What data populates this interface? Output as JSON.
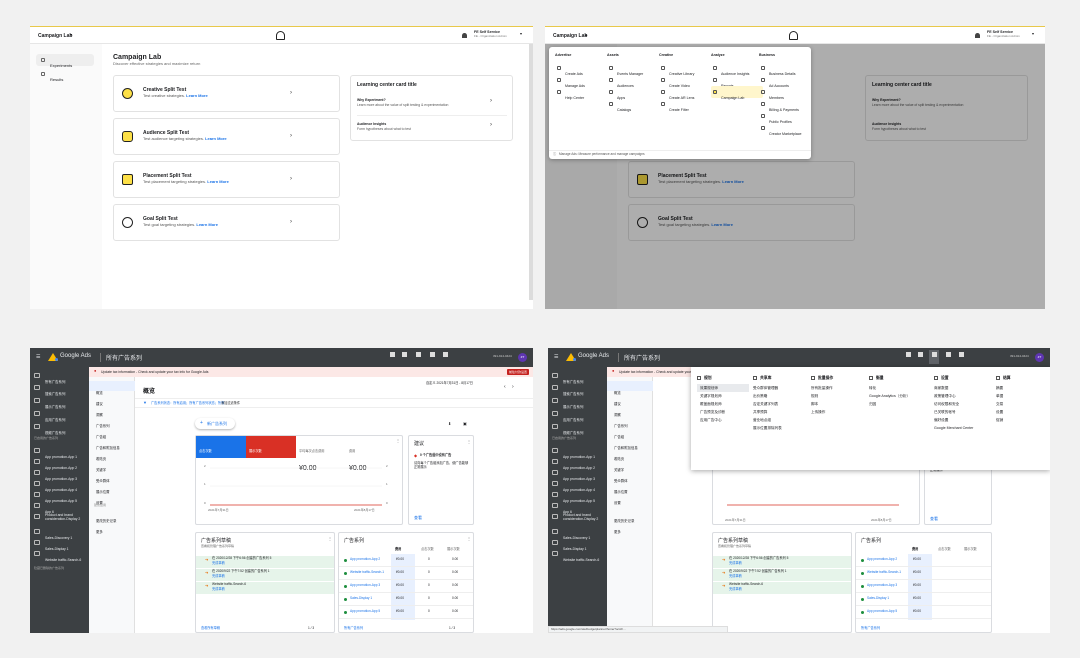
{
  "snap": {
    "brand": "Campaign Lab",
    "account_name": "FE Self Service",
    "account_sub": "FE - Organization Admin",
    "sidebar": [
      {
        "label": "Experiments"
      },
      {
        "label": "Results"
      }
    ],
    "title": "Campaign Lab",
    "subtitle": "Discover effective strategies and maximize return",
    "cards": [
      {
        "title": "Creative Split Test",
        "desc": "Test creative strategies.",
        "link": "Learn More"
      },
      {
        "title": "Audience Split Test",
        "desc": "Test audience targeting strategies.",
        "link": "Learn More"
      },
      {
        "title": "Placement Split Test",
        "desc": "Test placement targeting strategies.",
        "link": "Learn More"
      },
      {
        "title": "Goal Split Test",
        "desc": "Test goal targeting strategies.",
        "link": "Learn More"
      }
    ],
    "learning": {
      "title": "Learning center card title",
      "items": [
        {
          "title": "Why Experiment?",
          "desc": "Learn more about the value of split testing & experimentation"
        },
        {
          "title": "Audience Insights",
          "desc": "Form hypotheses about what to test"
        }
      ]
    },
    "menu": {
      "columns": [
        {
          "header": "Advertise",
          "items": [
            "Create Ads",
            "Manage Ads",
            "Help Center"
          ]
        },
        {
          "header": "Assets",
          "items": [
            "Events Manager",
            "Audiences",
            "Apps",
            "Catalogs"
          ]
        },
        {
          "header": "Creative",
          "items": [
            "Creative Library",
            "Create Video",
            "Create AR Lens",
            "Create Filter"
          ]
        },
        {
          "header": "Analyze",
          "items": [
            "Audience Insights",
            "Reports",
            "Campaign Lab"
          ]
        },
        {
          "header": "Business",
          "items": [
            "Business Details",
            "Ad Accounts",
            "Members",
            "Billing & Payments",
            "Public Profiles",
            "Creator Marketplace"
          ]
        }
      ],
      "footer": "Manage Ads: Measure performance and manage campaigns"
    }
  },
  "gads": {
    "product": "Google Ads",
    "page_title": "所有广告系列",
    "tools": [
      "搜索",
      "报告",
      "工具和设置",
      "帮助",
      "通知"
    ],
    "account_id": "391-914-0424",
    "avatar": "ZT",
    "banner": "Update tax information - Check and update your tax info for Google Ads",
    "banner_btn": "前往付款设置",
    "left_nav": [
      "所有广告系列",
      "搜索广告系列",
      "展示广告系列",
      "应用广告系列",
      "视频广告系列"
    ],
    "left_nav_group": "已启用的广告系列",
    "campaigns": [
      "App promotion-App 1",
      "App promotion-App 2",
      "App promotion-App 3",
      "App promotion-App 4",
      "App promotion-App 5",
      "App 6",
      "Product and brand consideration-Display 2",
      "Sales-Discovery 1",
      "Sales-Display 1",
      "Website traffic-Search-6"
    ],
    "left_footer": "隐藏已删除的广告系列",
    "sub_nav": [
      "概览",
      "建议",
      "洞察",
      "广告系列",
      "广告组",
      "广告和附加信息",
      "着陆页",
      "关键字",
      "受众群体",
      "展示位置",
      "设置",
      "更改历史记录"
    ],
    "sub_nav_group": "建议应用",
    "sub_nav_more": "更多",
    "overview": "概览",
    "filter_text": "广告系列状态：所有启用；所有广告系列状态；所有",
    "filter_add": "添加过滤条件",
    "date_range": "自定义 2021年7月31日 - 8月17日",
    "download": "下载",
    "feedback": "反馈",
    "new_campaign": "新广告系列",
    "metrics": [
      {
        "label": "点击次数",
        "value": "0"
      },
      {
        "label": "展示次数",
        "value": "0"
      },
      {
        "label": "平均每次点击费用",
        "value": "¥0.00"
      },
      {
        "label": "费用",
        "value": "¥0.00"
      }
    ],
    "chart_axis_left": [
      "2",
      "1",
      "0"
    ],
    "chart_axis_right": [
      "2",
      "1",
      "0"
    ],
    "chart_x_start": "2021年7月31日",
    "chart_x_end": "2021年8月17日",
    "suggest_title": "建议",
    "suggest_item": "0 个广告组中没有广告",
    "suggest_desc": "请向每个广告组添加广告，使广告能够正常展示",
    "view": "查看",
    "draft_title": "广告系列草稿",
    "draft_sub": "查看和管理广告系列草稿",
    "drafts": [
      {
        "title": "在 2020/12/28 下午6:56 创建的广告系列 5",
        "link": "完成草稿"
      },
      {
        "title": "在 2020/9/22 下午7:52 创建的广告系列 1",
        "link": "完成草稿"
      },
      {
        "title": "Website traffic-Search-6",
        "link": "完成草稿"
      }
    ],
    "all_drafts": "查看所有草稿",
    "camp_title": "广告系列",
    "camp_cols": [
      "费用",
      "点击次数",
      "展示次数"
    ],
    "camp_rows": [
      {
        "name": "App promotion-App 2",
        "cost": "¥0.00",
        "clicks": "0",
        "imp": "0.00"
      },
      {
        "name": "Website traffic-Search-1",
        "cost": "¥0.00",
        "clicks": "0",
        "imp": "0.00"
      },
      {
        "name": "App promotion-App 3",
        "cost": "¥0.00",
        "clicks": "0",
        "imp": "0.00"
      },
      {
        "name": "Sales-Display 1",
        "cost": "¥0.00",
        "clicks": "0",
        "imp": "0.00"
      },
      {
        "name": "App promotion-App 5",
        "cost": "¥0.00",
        "clicks": "0",
        "imp": "0.00"
      }
    ],
    "all_camps": "所有广告系列",
    "pager": "1 / 3",
    "status_url": "https://ads.google.com/aw/budgetplanner/home?ocid=...",
    "tools_menu": [
      {
        "header": "规划",
        "items": [
          "效果规划师",
          "关键字规划师",
          "覆盖面规划师",
          "广告预览及诊断",
          "应用广告中心"
        ]
      },
      {
        "header": "共享库",
        "items": [
          "受众群体管理器",
          "出价策略",
          "否定关键字列表",
          "共享预算",
          "营业地点组",
          "展示位置排除列表"
        ]
      },
      {
        "header": "批量操作",
        "items": [
          "所有批量操作",
          "规则",
          "脚本",
          "上传操作"
        ]
      },
      {
        "header": "衡量",
        "items": [
          "转化",
          "Google Analytics（分析）",
          "归因"
        ]
      },
      {
        "header": "设置",
        "items": [
          "商家数据",
          "政策管理中心",
          "访问权限和安全",
          "已关联的帐号",
          "偏好设置",
          "Google Merchant Center"
        ]
      },
      {
        "header": "结算",
        "items": [
          "摘要",
          "单据",
          "交易",
          "设置",
          "促销"
        ]
      }
    ]
  }
}
